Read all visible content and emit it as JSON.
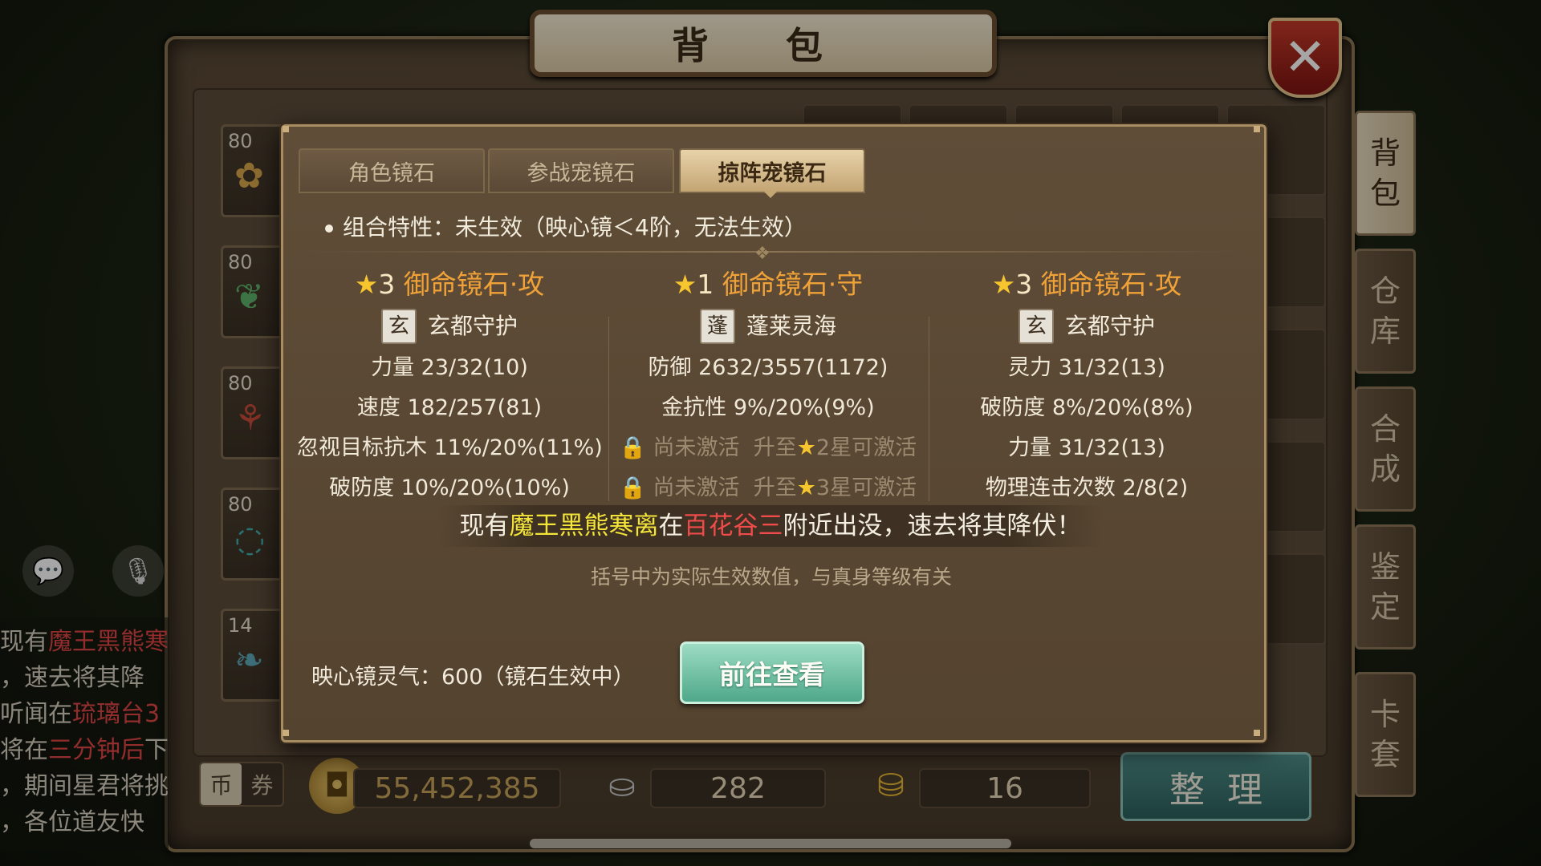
{
  "window": {
    "title": "背 包",
    "close_label": "✕"
  },
  "side_tabs": [
    {
      "label": "背\n包",
      "active": true
    },
    {
      "label": "仓\n库",
      "active": false
    },
    {
      "label": "合\n成",
      "active": false
    },
    {
      "label": "鉴\n定",
      "active": false
    },
    {
      "label": "卡\n套",
      "active": false
    }
  ],
  "left_items": [
    {
      "level": "80",
      "icon": "✿"
    },
    {
      "level": "80",
      "icon": "❦"
    },
    {
      "level": "80",
      "icon": "⚘"
    },
    {
      "level": "80",
      "icon": "◌"
    },
    {
      "level": "14",
      "icon": "❧"
    }
  ],
  "chat": {
    "lines": [
      {
        "prefix": "现有",
        "highlight": "魔王黑熊寒",
        "rest": ""
      },
      {
        "prefix": "，速去将其降",
        "highlight": "",
        "rest": ""
      },
      {
        "prefix": "听闻在",
        "highlight": "琉璃台3",
        "rest": ""
      },
      {
        "prefix": "将在",
        "highlight": "三分钟后",
        "rest": "下"
      },
      {
        "prefix": "，期间星君将挑",
        "highlight": "",
        "rest": ""
      },
      {
        "prefix": "，各位道友快",
        "highlight": "",
        "rest": ""
      }
    ],
    "chat_icon": "speech-bubble-icon",
    "mic_icon": "microphone-icon"
  },
  "currency": {
    "toggle": [
      "币",
      "券"
    ],
    "coins": "55,452,385",
    "silver": "282",
    "gold": "16",
    "sort_label": "整理"
  },
  "modal": {
    "tabs": [
      {
        "label": "角色镜石",
        "active": false
      },
      {
        "label": "参战宠镜石",
        "active": false
      },
      {
        "label": "掠阵宠镜石",
        "active": true
      }
    ],
    "combo_text": "组合特性：未生效（映心镜＜4阶，无法生效）",
    "columns": [
      {
        "stars": "3",
        "name": "御命镜石·攻",
        "badge": "玄",
        "set_name": "玄都守护",
        "rows": [
          {
            "text": "力量 23/32(10)"
          },
          {
            "text": "速度 182/257(81)"
          },
          {
            "text": "忽视目标抗木 11%/20%(11%)"
          },
          {
            "text": "破防度 10%/20%(10%)"
          }
        ]
      },
      {
        "stars": "1",
        "name": "御命镜石·守",
        "badge": "蓬",
        "set_name": "蓬莱灵海",
        "rows": [
          {
            "text": "防御 2632/3557(1172)"
          },
          {
            "text": "金抗性 9%/20%(9%)"
          },
          {
            "locked": "尚未激活",
            "upgrade": "升至",
            "req": "2星可激活"
          },
          {
            "locked": "尚未激活",
            "upgrade": "升至",
            "req": "3星可激活"
          }
        ]
      },
      {
        "stars": "3",
        "name": "御命镜石·攻",
        "badge": "玄",
        "set_name": "玄都守护",
        "rows": [
          {
            "text": "灵力 31/32(13)"
          },
          {
            "text": "破防度 8%/20%(8%)"
          },
          {
            "text": "力量 31/32(13)"
          },
          {
            "text": "物理连击次数 2/8(2)"
          }
        ]
      }
    ],
    "announce": {
      "part1": "现有",
      "boss": "魔王黑熊寒离",
      "part2": "在",
      "place": "百花谷三",
      "part3": "附近出没，速去将其降伏！"
    },
    "note": "括号中为实际生效数值，与真身等级有关",
    "aura_text": "映心镜灵气：600（镜石生效中）",
    "go_button": "前往查看"
  },
  "colors": {
    "accent_orange": "#f0a238",
    "star_gold": "#f7c62f",
    "announce_yellow": "#f3e43a",
    "announce_red": "#ef4b4b",
    "button_teal": "#4fa88a"
  }
}
